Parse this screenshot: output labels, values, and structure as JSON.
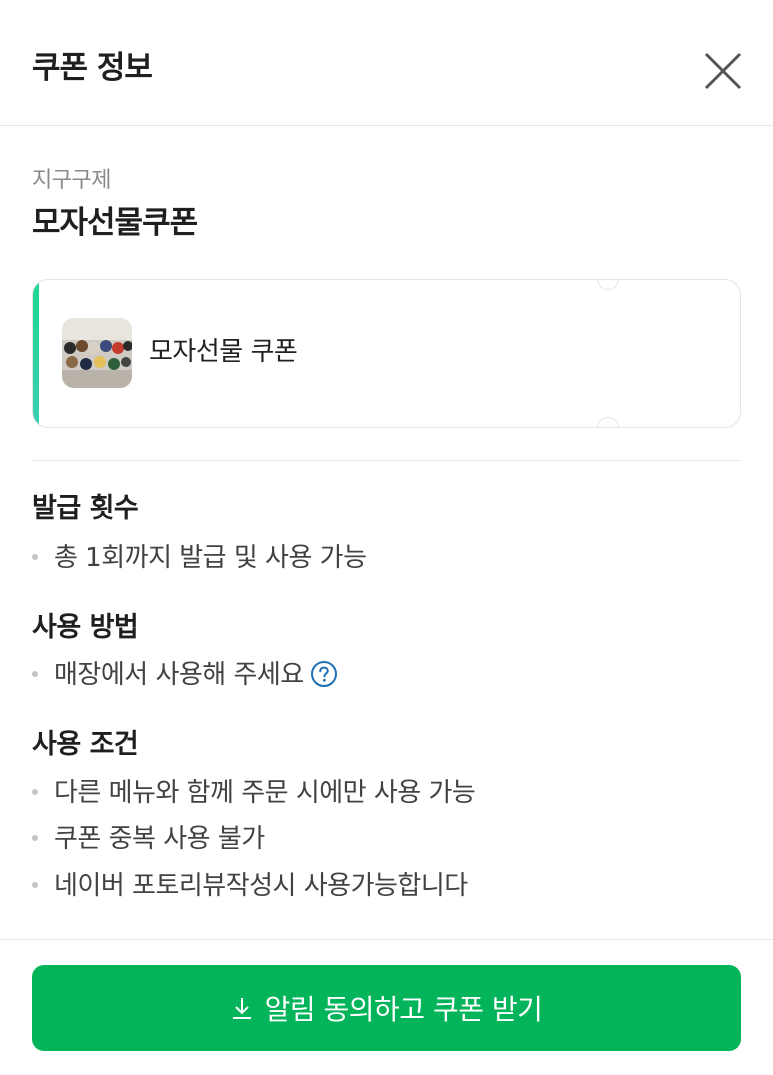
{
  "header": {
    "title": "쿠폰 정보",
    "close_icon": "close-icon"
  },
  "coupon": {
    "brand": "지구구제",
    "name": "모자선물쿠폰",
    "ticket_label": "모자선물 쿠폰",
    "accent_color": "#1ed790"
  },
  "sections": {
    "issue": {
      "title": "발급 횟수",
      "items": [
        "총 1회까지 발급 및 사용 가능"
      ]
    },
    "usage": {
      "title": "사용 방법",
      "items": [
        "매장에서 사용해 주세요"
      ],
      "help_icon": "question-circle-icon",
      "help_color": "#1f6fb5"
    },
    "conditions": {
      "title": "사용 조건",
      "items": [
        "다른 메뉴와 함께 주문 시에만 사용 가능",
        "쿠폰 중복 사용 불가",
        "네이버 포토리뷰작성시 사용가능합니다"
      ]
    }
  },
  "cta": {
    "label": "알림 동의하고 쿠폰 받기",
    "icon": "download-icon",
    "color": "#03b45a"
  }
}
